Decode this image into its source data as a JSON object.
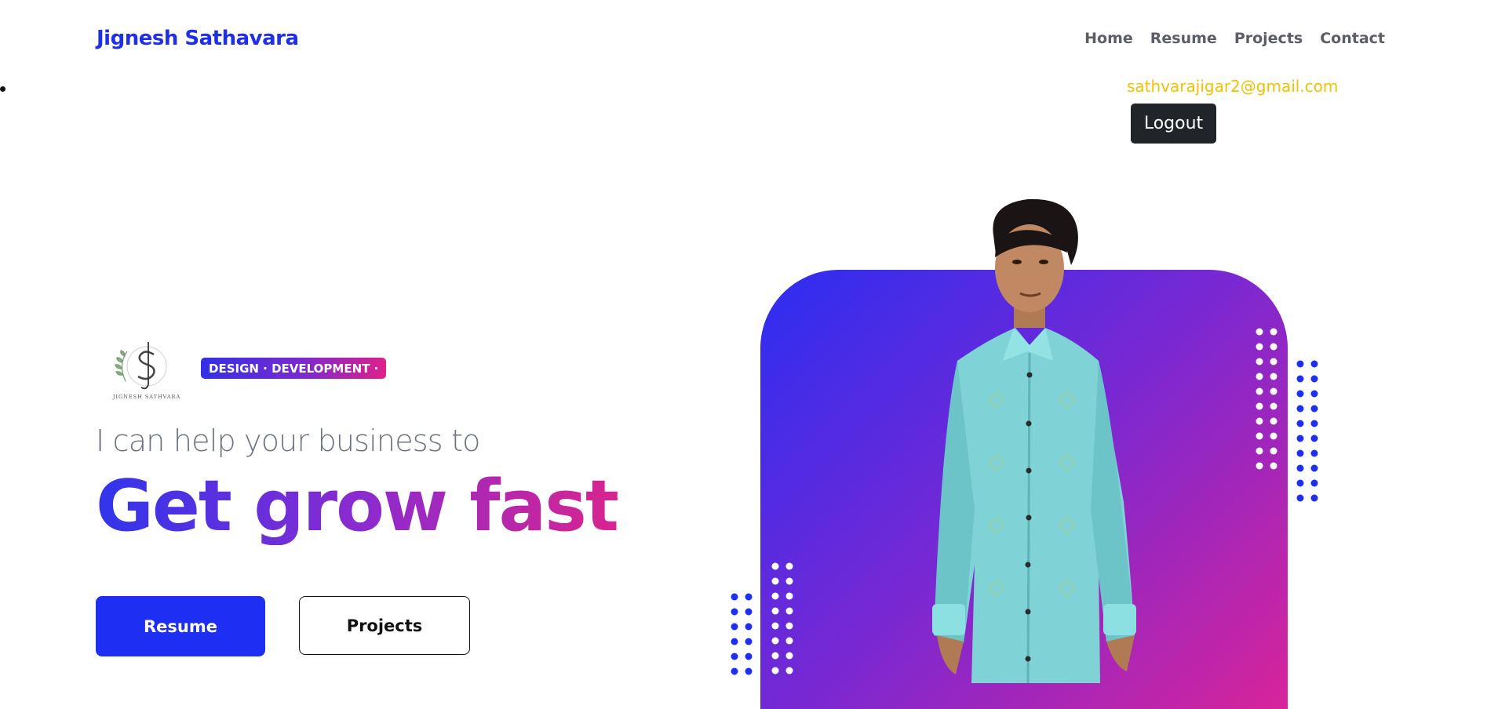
{
  "brand": {
    "name": "Jignesh Sathavara"
  },
  "nav": {
    "items": [
      "Home",
      "Resume",
      "Projects",
      "Contact"
    ]
  },
  "user": {
    "email": "sathvarajigar2@gmail.com",
    "logout_label": "Logout"
  },
  "hero": {
    "tag": "DESIGN · DEVELOPMENT ·",
    "logo_text": "JIGNESH SATHVARA",
    "subtitle": "I can help your business to",
    "headline": "Get grow fast",
    "primary_button": "Resume",
    "secondary_button": "Projects"
  },
  "colors": {
    "brand": "#1f2ee8",
    "email": "#f2c100",
    "gradient_start": "#2f35ec",
    "gradient_mid": "#8a2bd0",
    "gradient_end": "#d9248f",
    "dark_button": "#212529"
  }
}
